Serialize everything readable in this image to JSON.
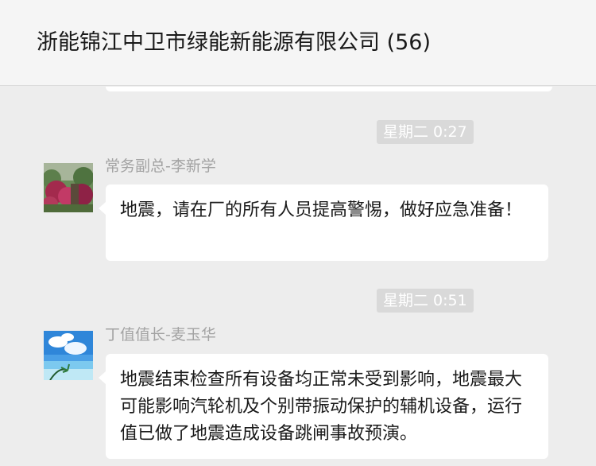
{
  "header": {
    "title": "浙能锦江中卫市绿能新能源有限公司 (56)"
  },
  "messages": [
    {
      "time": "星期二 0:27",
      "sender": "常务副总-李新学",
      "avatar": "flower-garden-photo-avatar",
      "text": "地震，请在厂的所有人员提高警惕，做好应急准备！"
    },
    {
      "time": "星期二 0:51",
      "sender": "丁值值长-麦玉华",
      "avatar": "beach-sky-photo-avatar",
      "text": "地震结束检查所有设备均正常未受到影响，地震最大可能影响汽轮机及个别带振动保护的辅机设备，运行值已做了地震造成设备跳闸事故预演。"
    }
  ],
  "colors": {
    "background": "#ededed",
    "header": "#f5f5f5",
    "bubble": "#ffffff",
    "time_badge": "#d9d9d9",
    "sender_text": "#a3a3a3"
  }
}
